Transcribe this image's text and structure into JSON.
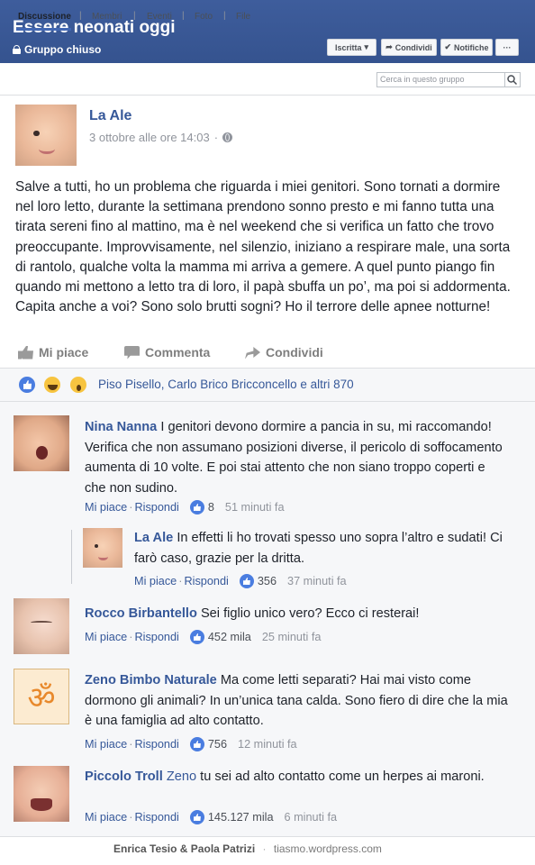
{
  "group": {
    "title": "Essere neonati oggi",
    "privacy": "Gruppo chiuso",
    "buttons": {
      "iscritta": "Iscritta",
      "condividi": "Condividi",
      "notifiche": "Notifiche",
      "more": "···"
    }
  },
  "tabs": [
    "Discussione",
    "Membri",
    "Eventi",
    "Foto",
    "File"
  ],
  "search": {
    "placeholder": "Cerca in questo gruppo"
  },
  "post": {
    "author": "La Ale",
    "time": "3 ottobre alle ore 14:03",
    "text": "Salve a tutti, ho un problema che riguarda i miei genitori. Sono tornati a dormire nel loro letto, durante la settimana prendono sonno presto e mi fanno tutta una tirata sereni fino al mattino, ma è nel weekend che si verifica un fatto che trovo preoccupante. Improvvisamente, nel silenzio, iniziano a respirare male, una sorta di rantolo, qualche volta la mamma mi arriva a gemere. A quel punto piango fin quando mi mettono a letto tra di loro, il papà sbuffa un po’, ma poi si addormenta. Capita anche a voi? Sono solo brutti sogni? Ho il terrore delle apnee notturne!",
    "actions": {
      "like": "Mi piace",
      "comment": "Commenta",
      "share": "Condividi"
    },
    "reactions_text": "Piso Pisello, Carlo Brico Bricconcello e altri 870"
  },
  "comments": [
    {
      "author": "Nina Nanna",
      "text": "I genitori devono dormire a pancia in su, mi raccomando! Verifica che non assumano posizioni diverse, il pericolo di soffocamento aumenta di 10 volte. E poi stai attento che non siano troppo coperti e che non sudino.",
      "likes": "8",
      "time": "51 minuti fa"
    },
    {
      "author": "La Ale",
      "text": "In effetti li ho trovati spesso uno sopra l’altro e sudati! Ci farò caso, grazie per la dritta.",
      "likes": "356",
      "time": "37 minuti fa"
    },
    {
      "author": "Rocco Birbantello",
      "text": "Sei figlio unico vero? Ecco ci resterai!",
      "likes": "452 mila",
      "time": "25 minuti fa"
    },
    {
      "author": "Zeno Bimbo Naturale",
      "text": "Ma come letti separati? Hai mai visto come dormono gli animali? In un’unica tana calda. Sono fiero di dire che la mia è una famiglia ad alto contatto.",
      "likes": "756",
      "time": "12 minuti fa"
    },
    {
      "author": "Piccolo Troll",
      "mention": "Zeno",
      "text": "tu sei ad alto contatto come un herpes ai maroni.",
      "likes": "145.127 mila",
      "time": "6 minuti fa"
    }
  ],
  "comment_actions": {
    "like": "Mi piace",
    "reply": "Rispondi",
    "sep": "·"
  },
  "footer": {
    "authors": "Enrica Tesio & Paola Patrizi",
    "sep": "·",
    "site": "tiasmo.wordpress.com"
  },
  "colors": {
    "header": "#3b5998",
    "link": "#365899",
    "like_blue": "#4a7de0",
    "om_orange": "#e8892c"
  }
}
